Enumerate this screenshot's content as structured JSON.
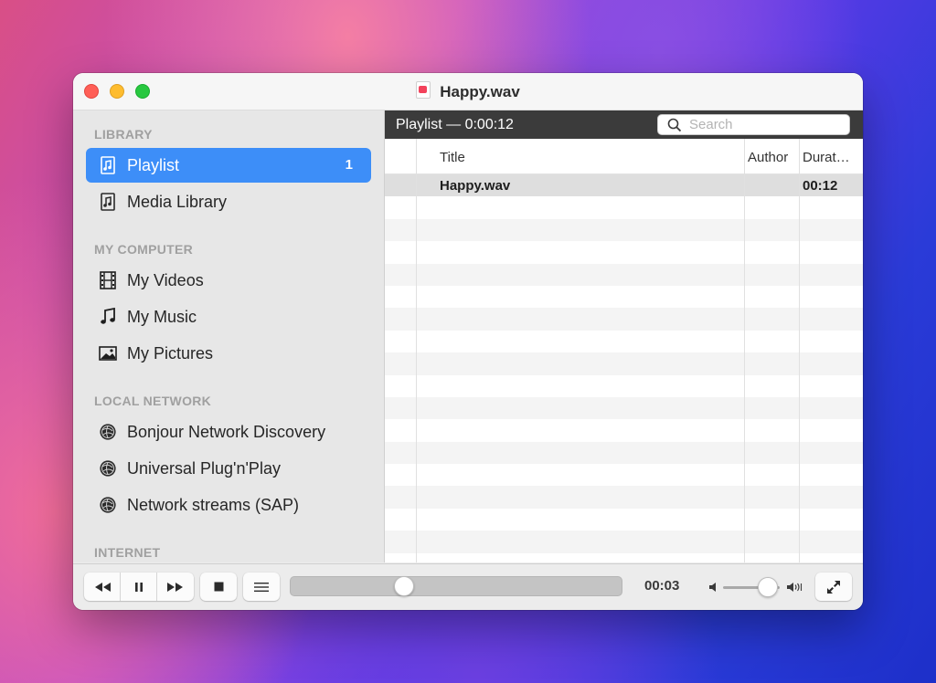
{
  "window": {
    "title": "Happy.wav",
    "title_icon": "audio-file-icon"
  },
  "sidebar": {
    "sections": [
      {
        "heading": "LIBRARY",
        "items": [
          {
            "label": "Playlist",
            "icon": "playlist-icon",
            "count": "1",
            "selected": true
          },
          {
            "label": "Media Library",
            "icon": "media-library-icon",
            "selected": false
          }
        ]
      },
      {
        "heading": "MY COMPUTER",
        "items": [
          {
            "label": "My Videos",
            "icon": "film-icon"
          },
          {
            "label": "My Music",
            "icon": "music-note-icon"
          },
          {
            "label": "My Pictures",
            "icon": "picture-icon"
          }
        ]
      },
      {
        "heading": "LOCAL NETWORK",
        "items": [
          {
            "label": "Bonjour Network Discovery",
            "icon": "network-globe-icon"
          },
          {
            "label": "Universal Plug'n'Play",
            "icon": "network-globe-icon"
          },
          {
            "label": "Network streams (SAP)",
            "icon": "network-globe-icon"
          }
        ]
      },
      {
        "heading": "INTERNET",
        "items": []
      }
    ]
  },
  "playlist": {
    "header": "Playlist — 0:00:12",
    "search_placeholder": "Search",
    "columns": [
      "Title",
      "Author",
      "Durat…"
    ],
    "rows": [
      {
        "title": "Happy.wav",
        "author": "",
        "duration": "00:12"
      }
    ]
  },
  "controls": {
    "elapsed": "00:03",
    "progress_fraction": 0.34,
    "volume_fraction": 0.78,
    "buttons": [
      "rewind-icon",
      "pause-icon",
      "fast-forward-icon",
      "stop-icon",
      "playlist-toggle-icon",
      "fullscreen-icon"
    ]
  },
  "colors": {
    "selection_accent": "#3d8ef8",
    "close": "#ff5f57",
    "minimize": "#febc2e",
    "zoom": "#28c840",
    "playlist_header_bg": "#3b3b3b"
  }
}
